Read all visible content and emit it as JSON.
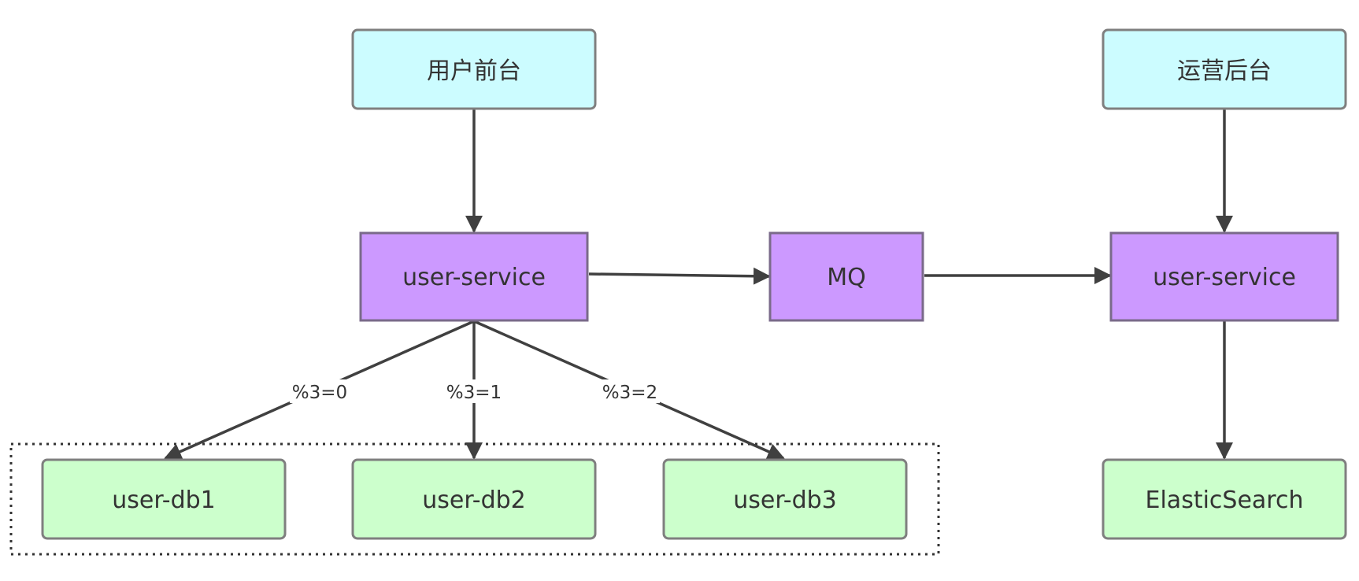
{
  "nodes": {
    "frontend": {
      "label": "用户前台",
      "kind": "client"
    },
    "ops": {
      "label": "运营后台",
      "kind": "client"
    },
    "user_service_a": {
      "label": "user-service",
      "kind": "service"
    },
    "mq": {
      "label": "MQ",
      "kind": "service"
    },
    "user_service_b": {
      "label": "user-service",
      "kind": "service"
    },
    "db1": {
      "label": "user-db1",
      "kind": "storage"
    },
    "db2": {
      "label": "user-db2",
      "kind": "storage"
    },
    "db3": {
      "label": "user-db3",
      "kind": "storage"
    },
    "es": {
      "label": "ElasticSearch",
      "kind": "storage"
    }
  },
  "edges": [
    {
      "from": "frontend",
      "to": "user_service_a",
      "label": ""
    },
    {
      "from": "user_service_a",
      "to": "mq",
      "label": ""
    },
    {
      "from": "mq",
      "to": "user_service_b",
      "label": ""
    },
    {
      "from": "ops",
      "to": "user_service_b",
      "label": ""
    },
    {
      "from": "user_service_b",
      "to": "es",
      "label": ""
    },
    {
      "from": "user_service_a",
      "to": "db1",
      "label": "%3=0"
    },
    {
      "from": "user_service_a",
      "to": "db2",
      "label": "%3=1"
    },
    {
      "from": "user_service_a",
      "to": "db3",
      "label": "%3=2"
    }
  ],
  "edge_labels": {
    "mod0": "%3=0",
    "mod1": "%3=1",
    "mod2": "%3=2"
  },
  "colors": {
    "client_fill": "#ccfcff",
    "service_fill": "#cc99ff",
    "storage_fill": "#ccffcc",
    "node_stroke": "#7f7f7f",
    "service_stroke": "#7a6a8a",
    "arrow": "#404040",
    "group_border": "#333333"
  }
}
